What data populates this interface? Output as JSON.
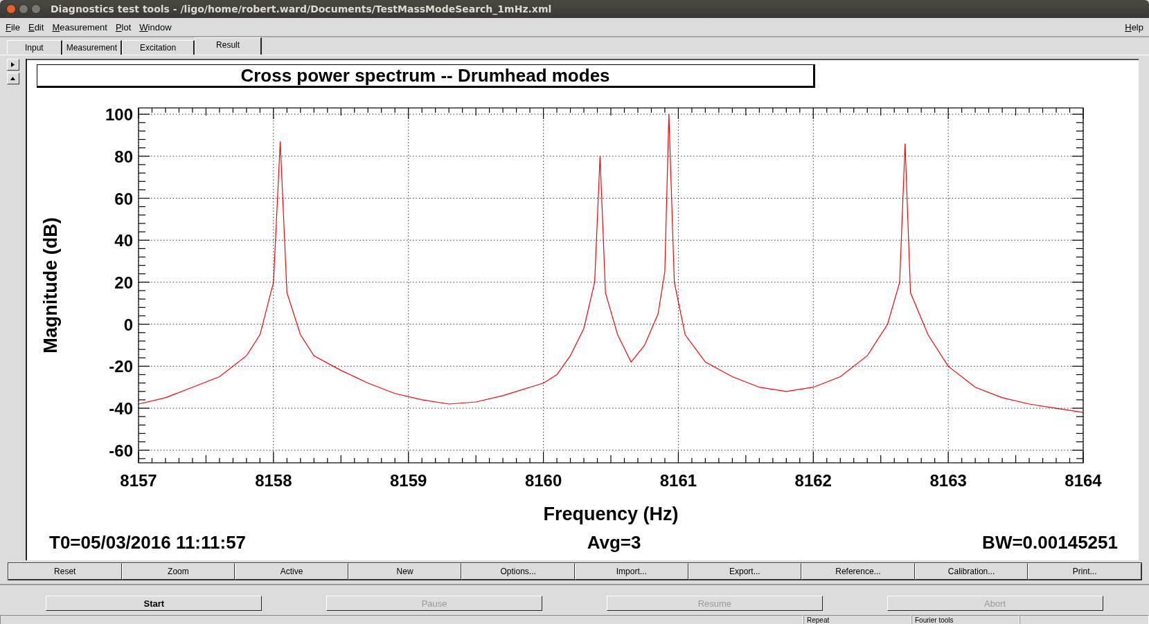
{
  "window": {
    "title": "Diagnostics test tools - /ligo/home/robert.ward/Documents/TestMassModeSearch_1mHz.xml"
  },
  "menu": [
    "File",
    "Edit",
    "Measurement",
    "Plot",
    "Window"
  ],
  "help_menu": "Help",
  "tabs": [
    {
      "label": "Input",
      "selected": false
    },
    {
      "label": "Measurement",
      "selected": false
    },
    {
      "label": "Excitation",
      "selected": false
    },
    {
      "label": "Result",
      "selected": true
    }
  ],
  "plot": {
    "title": "Cross power spectrum -- Drumhead modes",
    "chart_data": {
      "type": "line",
      "xlabel": "Frequency (Hz)",
      "ylabel": "Magnitude (dB)",
      "xlim": [
        8157,
        8164
      ],
      "ylim": [
        -66,
        103
      ],
      "xticks": [
        8157,
        8158,
        8159,
        8160,
        8161,
        8162,
        8163,
        8164
      ],
      "yticks": [
        -60,
        -40,
        -20,
        0,
        20,
        40,
        60,
        80,
        100
      ],
      "x": [
        8157.0,
        8157.2,
        8157.4,
        8157.6,
        8157.8,
        8157.9,
        8158.0,
        8158.05,
        8158.1,
        8158.2,
        8158.3,
        8158.5,
        8158.7,
        8158.9,
        8159.1,
        8159.3,
        8159.5,
        8159.7,
        8159.9,
        8160.0,
        8160.1,
        8160.2,
        8160.3,
        8160.38,
        8160.42,
        8160.46,
        8160.55,
        8160.65,
        8160.75,
        8160.85,
        8160.9,
        8160.93,
        8160.97,
        8161.05,
        8161.2,
        8161.4,
        8161.6,
        8161.8,
        8162.0,
        8162.2,
        8162.4,
        8162.55,
        8162.64,
        8162.68,
        8162.72,
        8162.85,
        8163.0,
        8163.2,
        8163.4,
        8163.6,
        8163.8,
        8164.0
      ],
      "grid": true,
      "series": [
        {
          "color": "#ff0000",
          "values": [
            -38,
            -35,
            -30,
            -25,
            -15,
            -5,
            20,
            87,
            15,
            -5,
            -15,
            -22,
            -28,
            -33,
            -36,
            -38,
            -37,
            -34,
            -30,
            -28,
            -24,
            -15,
            -2,
            20,
            80,
            15,
            -5,
            -18,
            -10,
            5,
            25,
            100,
            20,
            -5,
            -18,
            -25,
            -30,
            -32,
            -30,
            -25,
            -15,
            0,
            20,
            86,
            15,
            -5,
            -20,
            -30,
            -35,
            -38,
            -40,
            -42
          ]
        }
      ]
    },
    "footer": {
      "t0": "T0=05/03/2016 11:11:57",
      "avg": "Avg=3",
      "bw": "BW=0.00145251"
    }
  },
  "plot_buttons": [
    "Reset",
    "Zoom",
    "Active",
    "New",
    "Options...",
    "Import...",
    "Export...",
    "Reference...",
    "Calibration...",
    "Print..."
  ],
  "run_buttons": [
    {
      "label": "Start",
      "disabled": false
    },
    {
      "label": "Pause",
      "disabled": true
    },
    {
      "label": "Resume",
      "disabled": true
    },
    {
      "label": "Abort",
      "disabled": true
    }
  ],
  "status_bar": [
    "Repeat",
    "Fourier tools"
  ]
}
